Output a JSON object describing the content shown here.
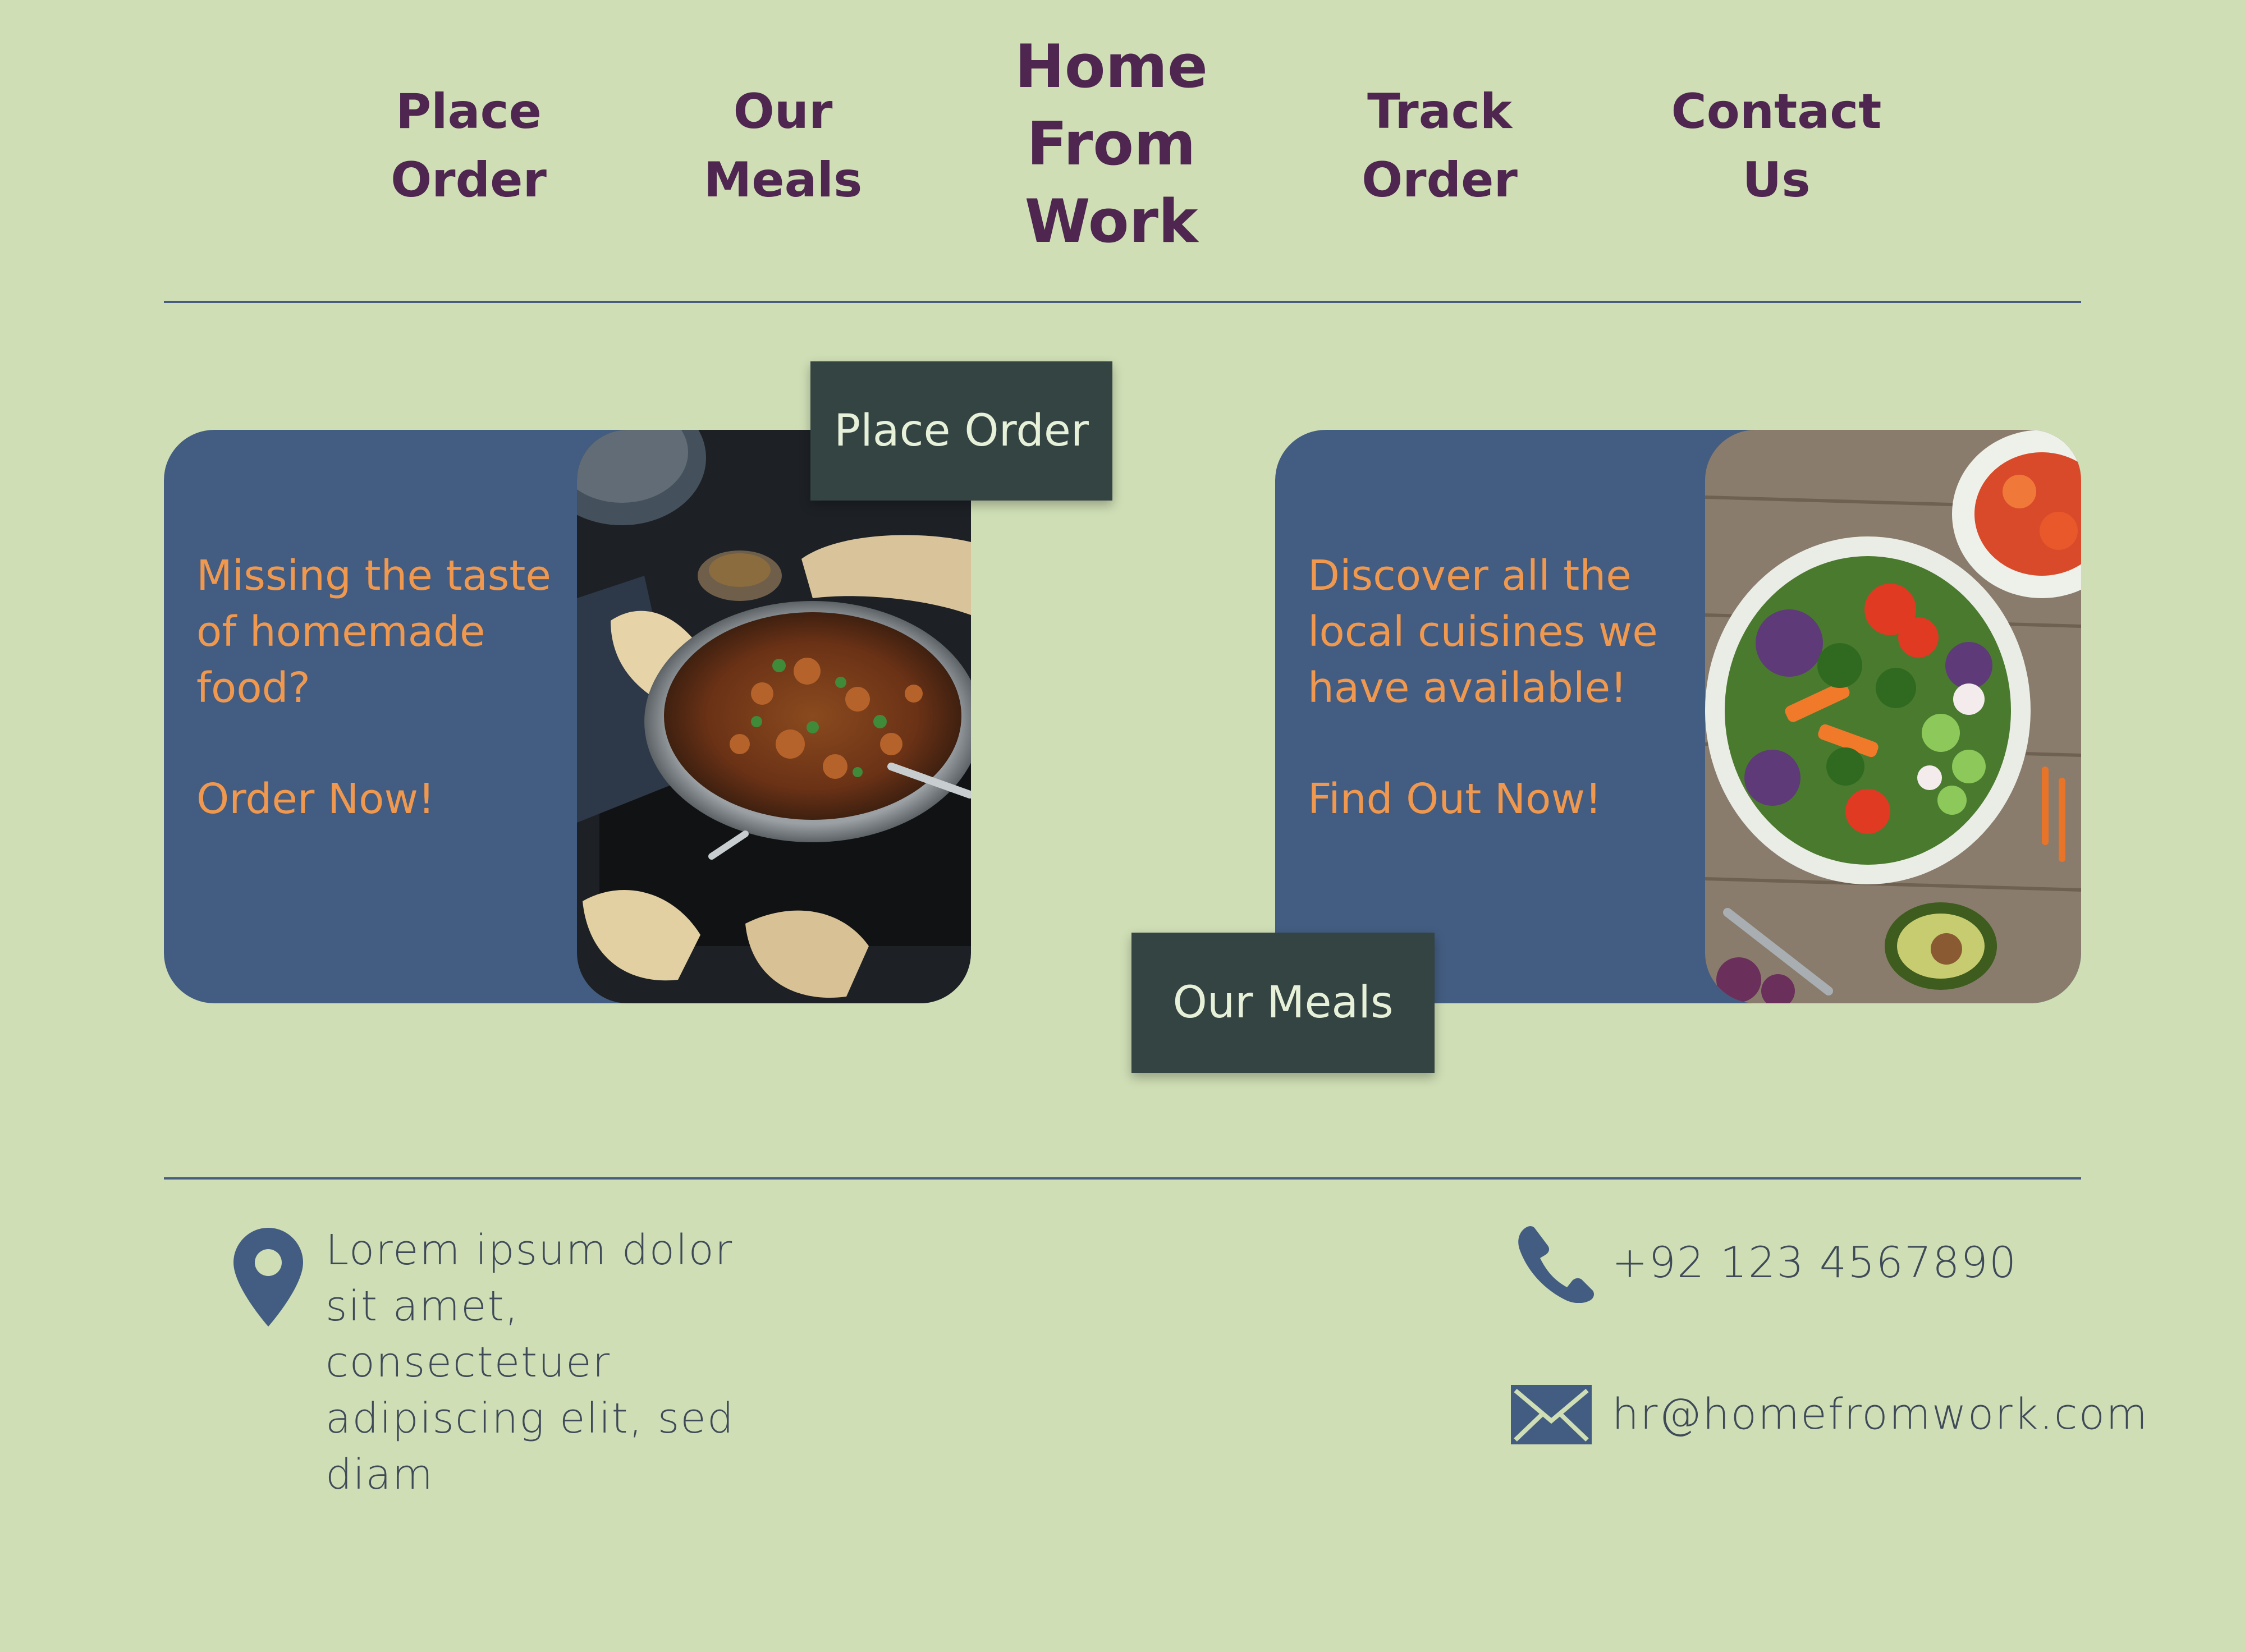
{
  "header": {
    "nav_left": [
      {
        "label": "Place\nOrder"
      },
      {
        "label": "Our\nMeals"
      }
    ],
    "logo": "Home\nFrom\nWork",
    "nav_right": [
      {
        "label": "Track\nOrder"
      },
      {
        "label": "Contact\nUs"
      }
    ]
  },
  "promo_cards": [
    {
      "text": "Missing the taste of homemade food?",
      "cta": "Order Now!",
      "button": "Place Order",
      "image": "curry-dish"
    },
    {
      "text": "Discover all the local cuisines we have available!",
      "cta": "Find Out Now!",
      "button": "Our Meals",
      "image": "salad-bowl"
    }
  ],
  "footer": {
    "address": "Lorem ipsum dolor sit amet, consectetuer adipiscing elit, sed diam",
    "phone": "+92 123 4567890",
    "email": "hr@homefromwork.com",
    "icons": [
      "location-pin-icon",
      "phone-icon",
      "mail-icon"
    ]
  },
  "colors": {
    "background": "#cfdeb5",
    "nav_text": "#4e2650",
    "card": "#435d82",
    "card_text": "#f0984e",
    "button": "#344443",
    "button_text": "#e7f0d8",
    "footer_text": "#3e4a58"
  }
}
